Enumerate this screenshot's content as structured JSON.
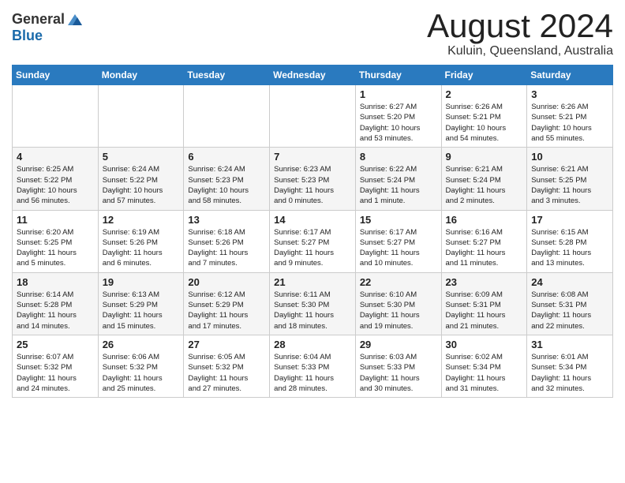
{
  "header": {
    "logo_general": "General",
    "logo_blue": "Blue",
    "month_title": "August 2024",
    "location": "Kuluin, Queensland, Australia"
  },
  "weekdays": [
    "Sunday",
    "Monday",
    "Tuesday",
    "Wednesday",
    "Thursday",
    "Friday",
    "Saturday"
  ],
  "rows": [
    [
      {
        "day": "",
        "info": ""
      },
      {
        "day": "",
        "info": ""
      },
      {
        "day": "",
        "info": ""
      },
      {
        "day": "",
        "info": ""
      },
      {
        "day": "1",
        "info": "Sunrise: 6:27 AM\nSunset: 5:20 PM\nDaylight: 10 hours\nand 53 minutes."
      },
      {
        "day": "2",
        "info": "Sunrise: 6:26 AM\nSunset: 5:21 PM\nDaylight: 10 hours\nand 54 minutes."
      },
      {
        "day": "3",
        "info": "Sunrise: 6:26 AM\nSunset: 5:21 PM\nDaylight: 10 hours\nand 55 minutes."
      }
    ],
    [
      {
        "day": "4",
        "info": "Sunrise: 6:25 AM\nSunset: 5:22 PM\nDaylight: 10 hours\nand 56 minutes."
      },
      {
        "day": "5",
        "info": "Sunrise: 6:24 AM\nSunset: 5:22 PM\nDaylight: 10 hours\nand 57 minutes."
      },
      {
        "day": "6",
        "info": "Sunrise: 6:24 AM\nSunset: 5:23 PM\nDaylight: 10 hours\nand 58 minutes."
      },
      {
        "day": "7",
        "info": "Sunrise: 6:23 AM\nSunset: 5:23 PM\nDaylight: 11 hours\nand 0 minutes."
      },
      {
        "day": "8",
        "info": "Sunrise: 6:22 AM\nSunset: 5:24 PM\nDaylight: 11 hours\nand 1 minute."
      },
      {
        "day": "9",
        "info": "Sunrise: 6:21 AM\nSunset: 5:24 PM\nDaylight: 11 hours\nand 2 minutes."
      },
      {
        "day": "10",
        "info": "Sunrise: 6:21 AM\nSunset: 5:25 PM\nDaylight: 11 hours\nand 3 minutes."
      }
    ],
    [
      {
        "day": "11",
        "info": "Sunrise: 6:20 AM\nSunset: 5:25 PM\nDaylight: 11 hours\nand 5 minutes."
      },
      {
        "day": "12",
        "info": "Sunrise: 6:19 AM\nSunset: 5:26 PM\nDaylight: 11 hours\nand 6 minutes."
      },
      {
        "day": "13",
        "info": "Sunrise: 6:18 AM\nSunset: 5:26 PM\nDaylight: 11 hours\nand 7 minutes."
      },
      {
        "day": "14",
        "info": "Sunrise: 6:17 AM\nSunset: 5:27 PM\nDaylight: 11 hours\nand 9 minutes."
      },
      {
        "day": "15",
        "info": "Sunrise: 6:17 AM\nSunset: 5:27 PM\nDaylight: 11 hours\nand 10 minutes."
      },
      {
        "day": "16",
        "info": "Sunrise: 6:16 AM\nSunset: 5:27 PM\nDaylight: 11 hours\nand 11 minutes."
      },
      {
        "day": "17",
        "info": "Sunrise: 6:15 AM\nSunset: 5:28 PM\nDaylight: 11 hours\nand 13 minutes."
      }
    ],
    [
      {
        "day": "18",
        "info": "Sunrise: 6:14 AM\nSunset: 5:28 PM\nDaylight: 11 hours\nand 14 minutes."
      },
      {
        "day": "19",
        "info": "Sunrise: 6:13 AM\nSunset: 5:29 PM\nDaylight: 11 hours\nand 15 minutes."
      },
      {
        "day": "20",
        "info": "Sunrise: 6:12 AM\nSunset: 5:29 PM\nDaylight: 11 hours\nand 17 minutes."
      },
      {
        "day": "21",
        "info": "Sunrise: 6:11 AM\nSunset: 5:30 PM\nDaylight: 11 hours\nand 18 minutes."
      },
      {
        "day": "22",
        "info": "Sunrise: 6:10 AM\nSunset: 5:30 PM\nDaylight: 11 hours\nand 19 minutes."
      },
      {
        "day": "23",
        "info": "Sunrise: 6:09 AM\nSunset: 5:31 PM\nDaylight: 11 hours\nand 21 minutes."
      },
      {
        "day": "24",
        "info": "Sunrise: 6:08 AM\nSunset: 5:31 PM\nDaylight: 11 hours\nand 22 minutes."
      }
    ],
    [
      {
        "day": "25",
        "info": "Sunrise: 6:07 AM\nSunset: 5:32 PM\nDaylight: 11 hours\nand 24 minutes."
      },
      {
        "day": "26",
        "info": "Sunrise: 6:06 AM\nSunset: 5:32 PM\nDaylight: 11 hours\nand 25 minutes."
      },
      {
        "day": "27",
        "info": "Sunrise: 6:05 AM\nSunset: 5:32 PM\nDaylight: 11 hours\nand 27 minutes."
      },
      {
        "day": "28",
        "info": "Sunrise: 6:04 AM\nSunset: 5:33 PM\nDaylight: 11 hours\nand 28 minutes."
      },
      {
        "day": "29",
        "info": "Sunrise: 6:03 AM\nSunset: 5:33 PM\nDaylight: 11 hours\nand 30 minutes."
      },
      {
        "day": "30",
        "info": "Sunrise: 6:02 AM\nSunset: 5:34 PM\nDaylight: 11 hours\nand 31 minutes."
      },
      {
        "day": "31",
        "info": "Sunrise: 6:01 AM\nSunset: 5:34 PM\nDaylight: 11 hours\nand 32 minutes."
      }
    ]
  ]
}
